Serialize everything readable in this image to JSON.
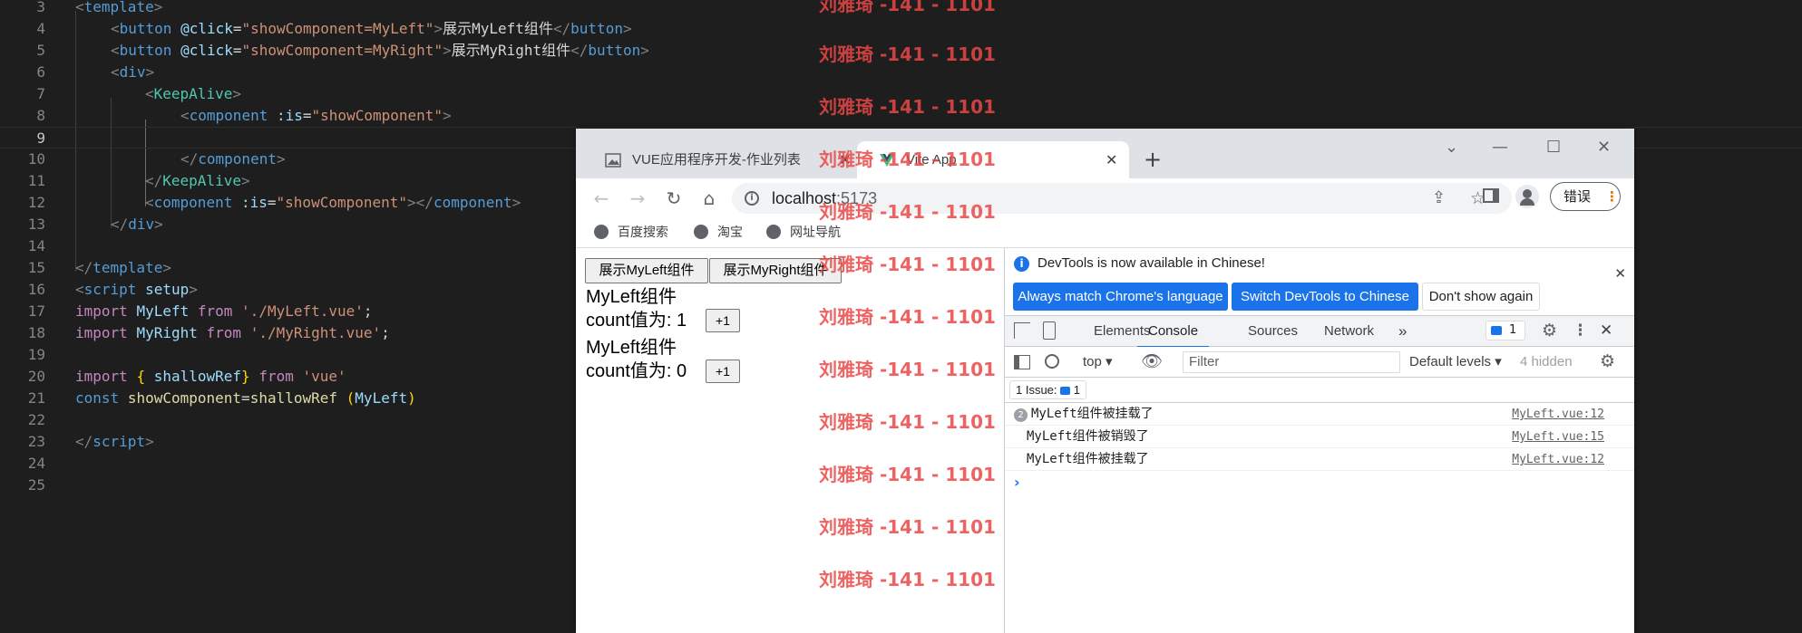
{
  "editor": {
    "lines": [
      {
        "n": "3"
      },
      {
        "n": "4"
      },
      {
        "n": "5"
      },
      {
        "n": "6"
      },
      {
        "n": "7"
      },
      {
        "n": "8"
      },
      {
        "n": "9"
      },
      {
        "n": "10"
      },
      {
        "n": "11"
      },
      {
        "n": "12"
      },
      {
        "n": "13"
      },
      {
        "n": "14"
      },
      {
        "n": "15"
      },
      {
        "n": "16"
      },
      {
        "n": "17"
      },
      {
        "n": "18"
      },
      {
        "n": "19"
      },
      {
        "n": "20"
      },
      {
        "n": "21"
      },
      {
        "n": "22"
      },
      {
        "n": "23"
      },
      {
        "n": "24"
      },
      {
        "n": "25"
      }
    ],
    "code": {
      "l3_tag": "template",
      "l4_tag": "button",
      "l4_attr": "@click",
      "l4_val": "\"showComponent=MyLeft\"",
      "l4_text": "展示MyLeft组件",
      "l4_close": "button",
      "l5_tag": "button",
      "l5_attr": "@click",
      "l5_val": "\"showComponent=MyRight\"",
      "l5_text": "展示MyRight组件",
      "l5_close": "button",
      "l6_tag": "div",
      "l7_tag": "KeepAlive",
      "l8_tag": "component",
      "l8_attr": ":is",
      "l8_val": "\"showComponent\"",
      "l10_tag": "component",
      "l11_tag": "KeepAlive",
      "l12_tag": "component",
      "l12_attr": ":is",
      "l12_val": "\"showComponent\"",
      "l12_close": "component",
      "l13_tag": "div",
      "l15_tag": "template",
      "l16_tag": "script",
      "l16_attr": "setup",
      "l17_kw": "import",
      "l17_id": "MyLeft",
      "l17_from": "from",
      "l17_str": "'./MyLeft.vue'",
      "l18_kw": "import",
      "l18_id": "MyRight",
      "l18_from": "from",
      "l18_str": "'./MyRight.vue'",
      "l20_kw": "import",
      "l20_id": "shallowRef",
      "l20_from": "from",
      "l20_str": "'vue'",
      "l21_kw": "const",
      "l21_id": "showComponent",
      "l21_fn": "shallowRef",
      "l21_arg": "MyLeft",
      "l23_tag": "script"
    }
  },
  "watermark": "刘雅琦 -141 - 1101",
  "browser": {
    "tabs": [
      {
        "label": "VUE应用程序开发-作业列表"
      },
      {
        "label": "Vite App"
      }
    ],
    "new_tab": "+",
    "window": {
      "collapse": "⌄",
      "minimize": "—",
      "maximize": "☐",
      "close": "✕"
    },
    "url_host": "localhost",
    "url_port": ":5173",
    "error_label": "错误",
    "bookmarks": [
      "百度搜索",
      "淘宝",
      "网址导航"
    ]
  },
  "page": {
    "btn_left": "展示MyLeft组件",
    "btn_right": "展示MyRight组件",
    "comp1_title": "MyLeft组件",
    "comp1_count_label": "count值为:",
    "comp1_count": "1",
    "comp2_title": "MyLeft组件",
    "comp2_count_label": "count值为:",
    "comp2_count": "0",
    "inc_label": "+1"
  },
  "devtools": {
    "info_text": "DevTools is now available in Chinese!",
    "btn_match": "Always match Chrome's language",
    "btn_switch": "Switch DevTools to Chinese",
    "btn_dont": "Don't show again",
    "tabs": [
      "Elements",
      "Console",
      "Sources",
      "Network"
    ],
    "issues_badge": "1",
    "context": "top",
    "filter_placeholder": "Filter",
    "levels": "Default levels",
    "hidden": "4 hidden",
    "issue_bar": "1 Issue:",
    "issue_count": "1",
    "logs": [
      {
        "count": "2",
        "msg": "MyLeft组件被挂载了",
        "src": "MyLeft.vue:12"
      },
      {
        "count": "",
        "msg": "MyLeft组件被销毁了",
        "src": "MyLeft.vue:15"
      },
      {
        "count": "",
        "msg": "MyLeft组件被挂载了",
        "src": "MyLeft.vue:12"
      }
    ],
    "prompt": "›"
  }
}
